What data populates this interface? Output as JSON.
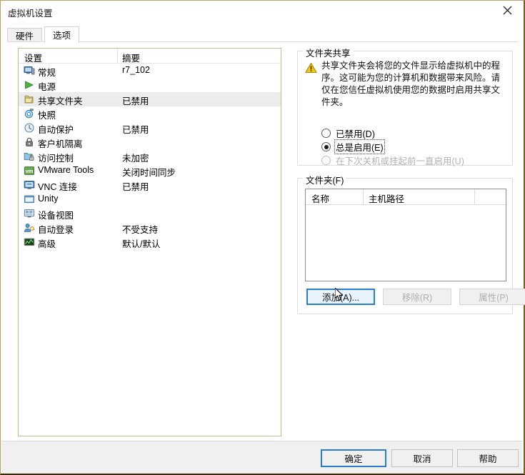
{
  "window": {
    "title": "虚拟机设置",
    "close_icon": "close-icon"
  },
  "tabs": [
    {
      "label": "硬件",
      "active": false
    },
    {
      "label": "选项",
      "active": true
    }
  ],
  "settings_list": {
    "columns": [
      "设置",
      "摘要"
    ],
    "rows": [
      {
        "icon": "monitor-icon",
        "label": "常规",
        "summary": "r7_102",
        "selected": false
      },
      {
        "icon": "power-play-icon",
        "label": "电源",
        "summary": "",
        "selected": false
      },
      {
        "icon": "shared-folder-icon",
        "label": "共享文件夹",
        "summary": "已禁用",
        "selected": true
      },
      {
        "icon": "snapshot-icon",
        "label": "快照",
        "summary": "",
        "selected": false
      },
      {
        "icon": "autoprotect-icon",
        "label": "自动保护",
        "summary": "已禁用",
        "selected": false
      },
      {
        "icon": "lock-icon",
        "label": "客户机隔离",
        "summary": "",
        "selected": false
      },
      {
        "icon": "access-control-icon",
        "label": "访问控制",
        "summary": "未加密",
        "selected": false
      },
      {
        "icon": "vmware-tools-icon",
        "label": "VMware Tools",
        "summary": "关闭时间同步",
        "selected": false
      },
      {
        "icon": "vnc-icon",
        "label": "VNC 连接",
        "summary": "已禁用",
        "selected": false
      },
      {
        "icon": "unity-icon",
        "label": "Unity",
        "summary": "",
        "selected": false
      },
      {
        "icon": "device-view-icon",
        "label": "设备视图",
        "summary": "",
        "selected": false
      },
      {
        "icon": "autologin-icon",
        "label": "自动登录",
        "summary": "不受支持",
        "selected": false
      },
      {
        "icon": "advanced-icon",
        "label": "高级",
        "summary": "默认/默认",
        "selected": false
      }
    ]
  },
  "folder_sharing": {
    "group_title": "文件夹共享",
    "warning_icon": "warning-icon",
    "warning_text": "共享文件夹会将您的文件显示给虚拟机中的程序。这可能为您的计算机和数据带来风险。请仅在您信任虚拟机使用您的数据时启用共享文件夹。",
    "options": [
      {
        "label": "已禁用(D)",
        "checked": false,
        "disabled": false,
        "focused": false
      },
      {
        "label": "总是启用(E)",
        "checked": true,
        "disabled": false,
        "focused": true
      },
      {
        "label": "在下次关机或挂起前一直启用(U)",
        "checked": false,
        "disabled": true,
        "focused": false
      }
    ]
  },
  "folders": {
    "group_title": "文件夹(F)",
    "columns": [
      "名称",
      "主机路径"
    ],
    "rows": [],
    "buttons": [
      {
        "label": "添加(A)...",
        "state": "focus"
      },
      {
        "label": "移除(R)",
        "state": "disabled"
      },
      {
        "label": "属性(P)",
        "state": "disabled"
      }
    ]
  },
  "dialog_buttons": [
    {
      "label": "确定",
      "state": "default"
    },
    {
      "label": "取消",
      "state": "normal"
    },
    {
      "label": "帮助",
      "state": "normal"
    }
  ],
  "colors": {
    "accent_blue": "#2b7dd1",
    "selected_row": "#ececec",
    "warning_yellow": "#f0c419",
    "window_border": "#7a5c1e"
  }
}
